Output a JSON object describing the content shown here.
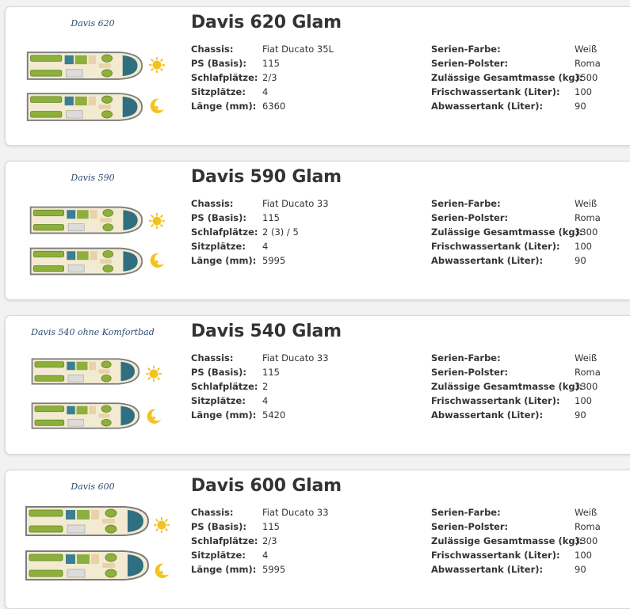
{
  "vehicles": [
    {
      "thumb_label": "Davis 620",
      "title": "Davis 620 Glam",
      "specs_left": [
        {
          "label": "Chassis:",
          "value": "Fiat Ducato 35L"
        },
        {
          "label": "PS (Basis):",
          "value": "115"
        },
        {
          "label": "Schlafplätze:",
          "value": "2/3"
        },
        {
          "label": "Sitzplätze:",
          "value": "4"
        },
        {
          "label": "Länge (mm):",
          "value": "6360"
        }
      ],
      "specs_right": [
        {
          "label": "Serien-Farbe:",
          "value": "Weiß"
        },
        {
          "label": "Serien-Polster:",
          "value": "Roma"
        },
        {
          "label": "Zulässige Gesamtmasse (kg):",
          "value": "3500"
        },
        {
          "label": "Frischwassertank (Liter):",
          "value": "100"
        },
        {
          "label": "Abwassertank (Liter):",
          "value": "90"
        }
      ]
    },
    {
      "thumb_label": "Davis 590",
      "title": "Davis 590 Glam",
      "specs_left": [
        {
          "label": "Chassis:",
          "value": "Fiat Ducato 33"
        },
        {
          "label": "PS (Basis):",
          "value": "115"
        },
        {
          "label": "Schlafplätze:",
          "value": "2 (3) / 5"
        },
        {
          "label": "Sitzplätze:",
          "value": "4"
        },
        {
          "label": "Länge (mm):",
          "value": "5995"
        }
      ],
      "specs_right": [
        {
          "label": "Serien-Farbe:",
          "value": "Weiß"
        },
        {
          "label": "Serien-Polster:",
          "value": "Roma"
        },
        {
          "label": "Zulässige Gesamtmasse (kg):",
          "value": "3300"
        },
        {
          "label": "Frischwassertank (Liter):",
          "value": "100"
        },
        {
          "label": "Abwassertank (Liter):",
          "value": "90"
        }
      ]
    },
    {
      "thumb_label": "Davis 540 ohne Komfortbad",
      "title": "Davis 540 Glam",
      "specs_left": [
        {
          "label": "Chassis:",
          "value": "Fiat Ducato 33"
        },
        {
          "label": "PS (Basis):",
          "value": "115"
        },
        {
          "label": "Schlafplätze:",
          "value": "2"
        },
        {
          "label": "Sitzplätze:",
          "value": "4"
        },
        {
          "label": "Länge (mm):",
          "value": "5420"
        }
      ],
      "specs_right": [
        {
          "label": "Serien-Farbe:",
          "value": "Weiß"
        },
        {
          "label": "Serien-Polster:",
          "value": "Roma"
        },
        {
          "label": "Zulässige Gesamtmasse (kg):",
          "value": "3300"
        },
        {
          "label": "Frischwassertank (Liter):",
          "value": "100"
        },
        {
          "label": "Abwassertank (Liter):",
          "value": "90"
        }
      ]
    },
    {
      "thumb_label": "Davis 600",
      "title": "Davis 600 Glam",
      "specs_left": [
        {
          "label": "Chassis:",
          "value": "Fiat Ducato 33"
        },
        {
          "label": "PS (Basis):",
          "value": "115"
        },
        {
          "label": "Schlafplätze:",
          "value": "2/3"
        },
        {
          "label": "Sitzplätze:",
          "value": "4"
        },
        {
          "label": "Länge (mm):",
          "value": "5995"
        }
      ],
      "specs_right": [
        {
          "label": "Serien-Farbe:",
          "value": "Weiß"
        },
        {
          "label": "Serien-Polster:",
          "value": "Roma"
        },
        {
          "label": "Zulässige Gesamtmasse (kg):",
          "value": "3300"
        },
        {
          "label": "Frischwassertank (Liter):",
          "value": "100"
        },
        {
          "label": "Abwassertank (Liter):",
          "value": "90"
        }
      ]
    }
  ],
  "icons": {
    "day": "sun-icon",
    "night": "moon-icon",
    "floorplan": "floorplan-image"
  },
  "colors": {
    "seat_green": "#8db03c",
    "cab_teal": "#2f6f80",
    "floor_cream": "#f3ead2",
    "sun_yellow": "#f4c21f",
    "title_text": "#333333"
  }
}
